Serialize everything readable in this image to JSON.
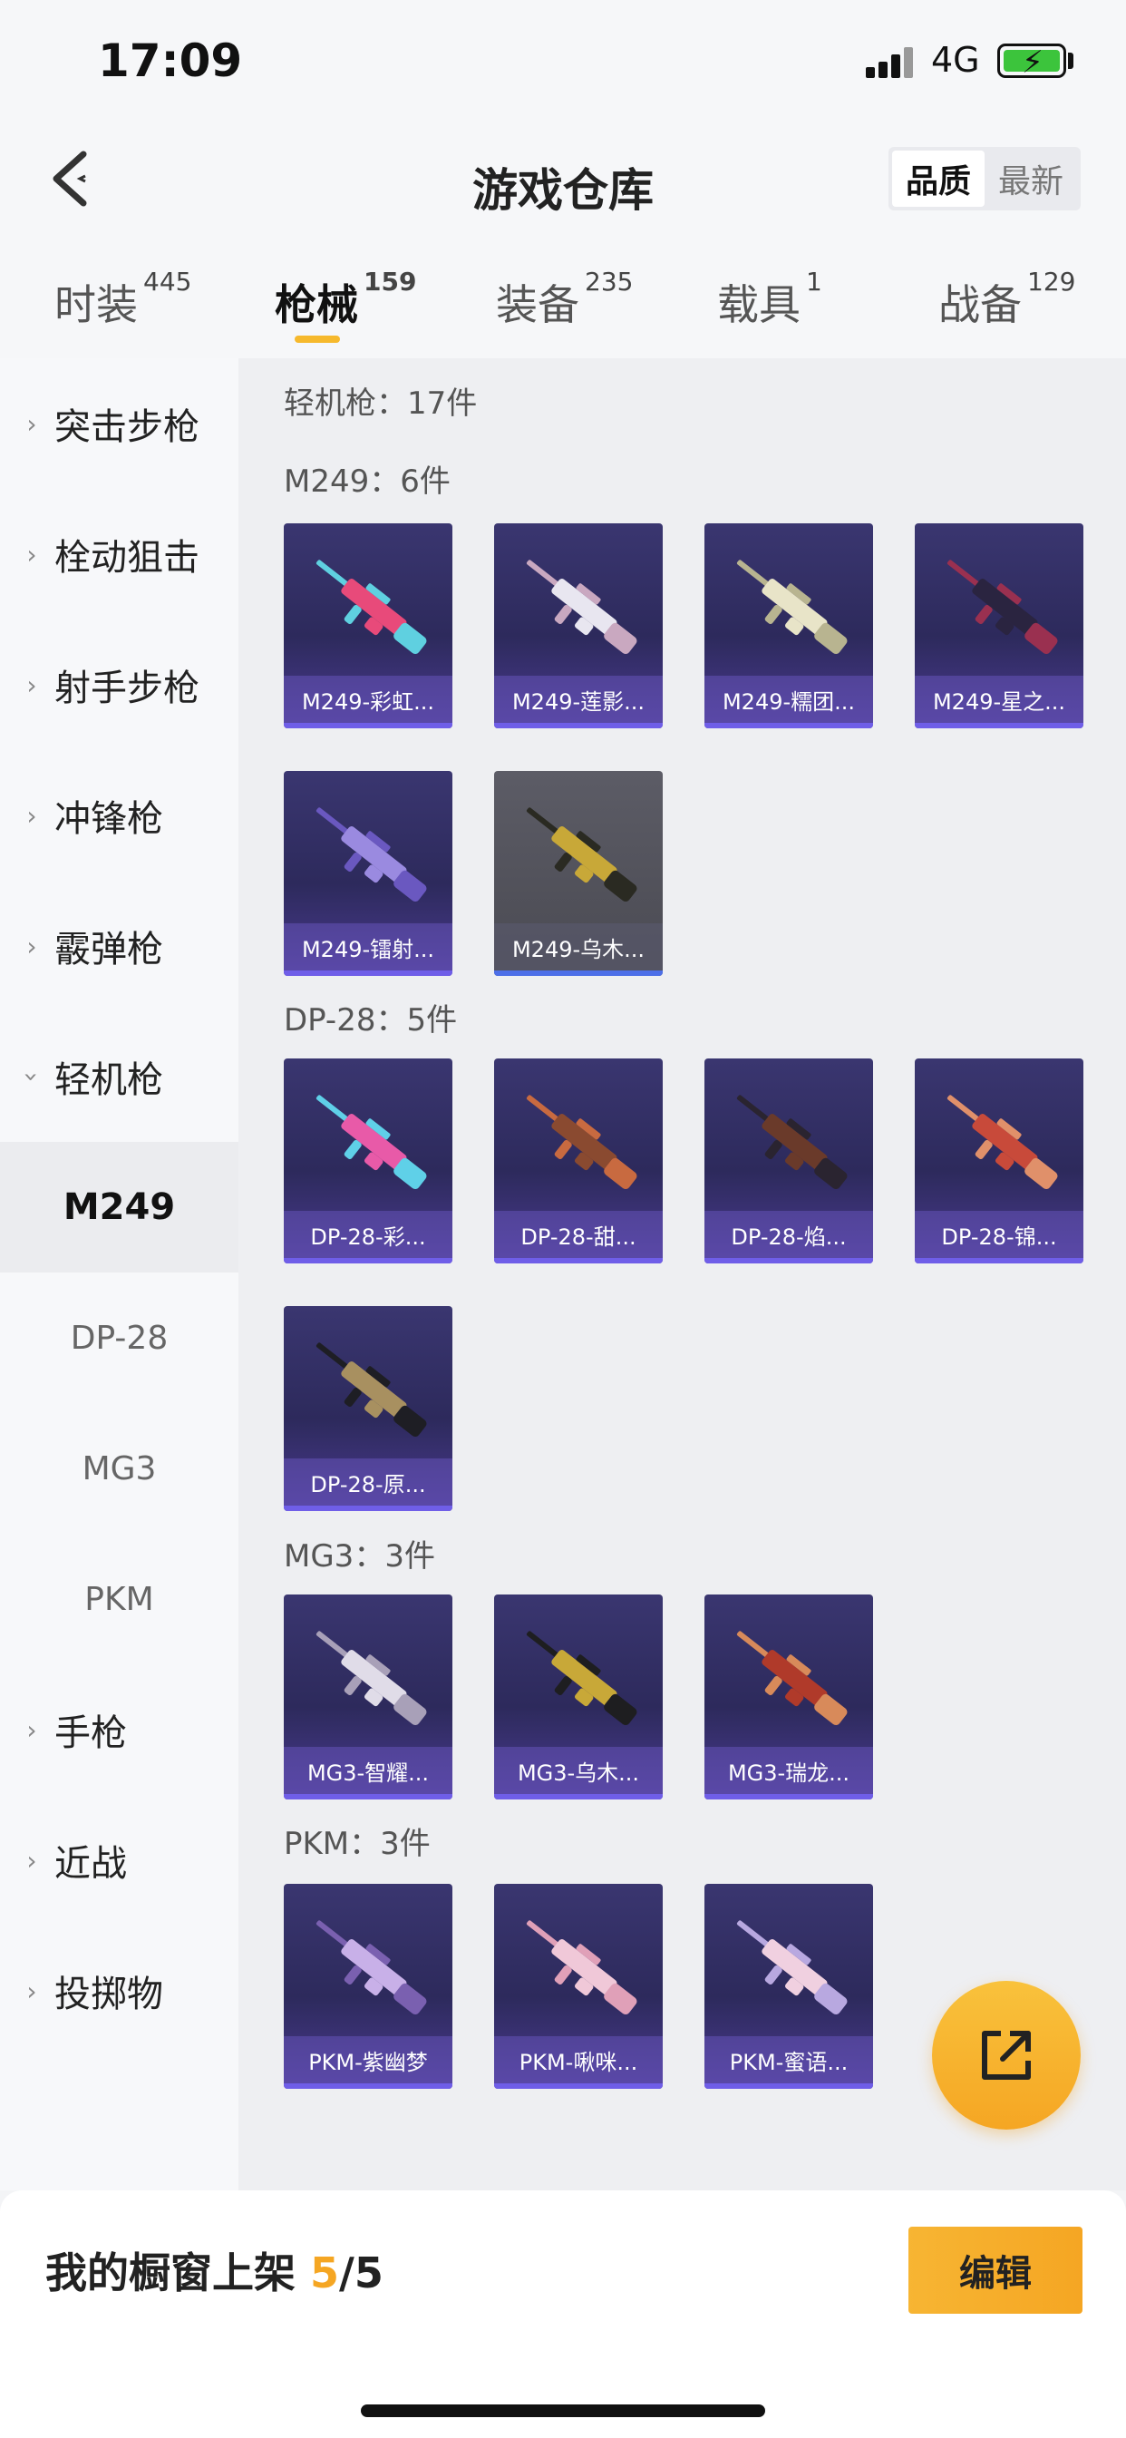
{
  "status": {
    "time": "17:09",
    "network": "4G"
  },
  "header": {
    "title": "游戏仓库",
    "sort_options": [
      "品质",
      "最新"
    ],
    "sort_selected": "品质"
  },
  "tabs": [
    {
      "label": "时装",
      "count": "445"
    },
    {
      "label": "枪械",
      "count": "159"
    },
    {
      "label": "装备",
      "count": "235"
    },
    {
      "label": "载具",
      "count": "1"
    },
    {
      "label": "战备",
      "count": "129"
    }
  ],
  "active_tab": "枪械",
  "sidebar": {
    "categories": [
      "突击步枪",
      "栓动狙击",
      "射手步枪",
      "冲锋枪",
      "霰弹枪",
      "轻机枪",
      "手枪",
      "近战",
      "投掷物"
    ],
    "expanded": "轻机枪",
    "subitems": [
      "M249",
      "DP-28",
      "MG3",
      "PKM"
    ],
    "selected_sub": "M249"
  },
  "content": {
    "summary": "轻机枪：17件",
    "sections": [
      {
        "title": "M249：6件",
        "items": [
          "M249-彩虹...",
          "M249-莲影...",
          "M249-糯团...",
          "M249-星之...",
          "M249-镭射...",
          "M249-乌木..."
        ]
      },
      {
        "title": "DP-28：5件",
        "items": [
          "DP-28-彩...",
          "DP-28-甜...",
          "DP-28-焰...",
          "DP-28-锦...",
          "DP-28-原..."
        ]
      },
      {
        "title": "MG3：3件",
        "items": [
          "MG3-智耀...",
          "MG3-乌木...",
          "MG3-瑞龙..."
        ]
      },
      {
        "title": "PKM：3件",
        "items": [
          "PKM-紫幽梦",
          "PKM-啾咪...",
          "PKM-蜜语..."
        ]
      }
    ]
  },
  "bottom": {
    "label": "我的橱窗上架",
    "shelf_used": "5",
    "shelf_sep": "/",
    "shelf_total": "5",
    "edit_label": "编辑"
  },
  "colors": {
    "accent": "#f5a623",
    "card_bg": "#2d2a5c",
    "card_strip": "#6f5ee8"
  },
  "icons": {
    "back": "chevron-left-icon",
    "fab": "share-external-icon"
  }
}
